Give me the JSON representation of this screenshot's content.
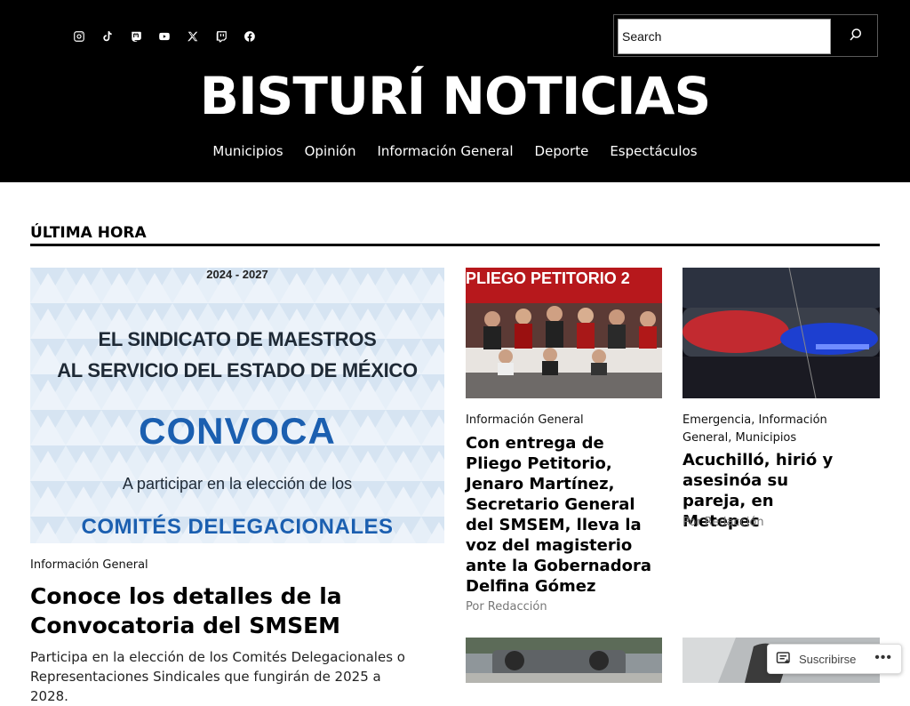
{
  "header": {
    "site_title": "BISTURÍ NOTICIAS",
    "search_placeholder": "Search",
    "social_icons": [
      "instagram-icon",
      "tiktok-icon",
      "mastodon-icon",
      "youtube-icon",
      "x-icon",
      "twitch-icon",
      "facebook-icon"
    ],
    "nav": [
      "Municipios",
      "Opinión",
      "Información General",
      "Deporte",
      "Espectáculos"
    ]
  },
  "section": {
    "title": "ÚLTIMA HORA"
  },
  "featured": {
    "poster": {
      "years": "2024 - 2027",
      "line1": "EL SINDICATO DE MAESTROS",
      "line2": "AL SERVICIO DEL ESTADO DE MÉXICO",
      "convoca": "CONVOCA",
      "line3": "A participar en la elección de los",
      "line4": "COMITÉS DELEGACIONALES"
    },
    "category": "Información General",
    "title": "Conoce los detalles de la Convocatoria del SMSEM",
    "excerpt": "Participa en la elección de los Comités Delegacionales o Representaciones Sindicales que fungirán de 2025 a 2028."
  },
  "articles": [
    {
      "image_text": "PLIEGO PETITORIO 2",
      "category": "Información General",
      "title": "Con entrega de Pliego Petitorio, Jenaro Martínez, Secretario General del SMSEM, lleva la voz del magisterio ante la Gobernadora Delfina Gómez",
      "byline": "Por Redacción"
    },
    {
      "category": "Emergencia, Información General, Municipios",
      "title": "Acuchilló, hirió y asesinóa su pareja, en Metepec",
      "byline": "Por Redacción"
    }
  ],
  "subscribe": {
    "label": "Suscribirse",
    "more": "•••"
  },
  "colors": {
    "header_bg": "#000000",
    "poster_blue": "#1b5fb0",
    "poster_bg": "#e4eef7",
    "text": "#000000",
    "muted": "#777777"
  }
}
